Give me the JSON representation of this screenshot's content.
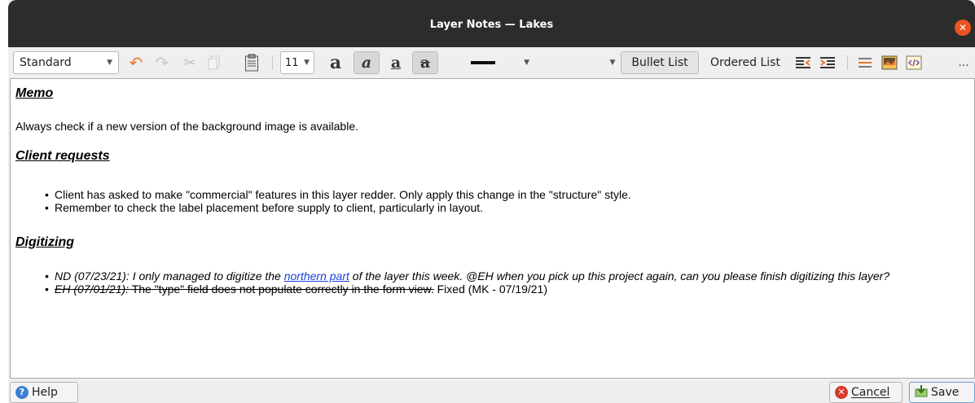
{
  "window": {
    "title": "Layer Notes — Lakes",
    "close_icon": "close-icon"
  },
  "toolbar": {
    "style_select": {
      "value": "Standard"
    },
    "undo_icon": "undo-icon",
    "redo_icon": "redo-icon",
    "cut_icon": "cut-icon",
    "copy_icon": "copy-icon",
    "paste_icon": "paste-icon",
    "font_size": {
      "value": "11"
    },
    "bold_label": "a",
    "italic_label": "a",
    "underline_label": "a",
    "strikethrough_label": "a",
    "bullet_list_label": "Bullet List",
    "ordered_list_label": "Ordered List",
    "more_label": "..."
  },
  "content": {
    "memo_heading": "Memo",
    "memo_text": "Always check if a new version of the background image is available.",
    "client_heading": "Client requests",
    "client_items": [
      "Client has asked to make \"commercial\" features in this layer redder. Only apply this change in the \"structure\" style.",
      "Remember to check the label placement before supply to client, particularly in layout."
    ],
    "digitizing_heading": "Digitizing",
    "digitizing_item1_before": "ND (07/23/21): I only managed to digitize the ",
    "digitizing_item1_link": "northern part",
    "digitizing_item1_after": " of the layer this week. @EH when you pick up this project again, can you please finish digitizing this layer?",
    "digitizing_item2_italic": "EH (07/01/21):",
    "digitizing_item2_strike": " The \"type\" field does not populate correctly in the form view.",
    "digitizing_item2_plain": " Fixed (MK - 07/19/21)"
  },
  "buttons": {
    "help_label": "Help",
    "cancel_label": "Cancel",
    "save_label": "Save"
  },
  "colors": {
    "accent_orange": "#e95420",
    "link_blue": "#1d3fd8",
    "help_blue": "#3d7fd6",
    "cancel_red": "#d63a2a"
  }
}
